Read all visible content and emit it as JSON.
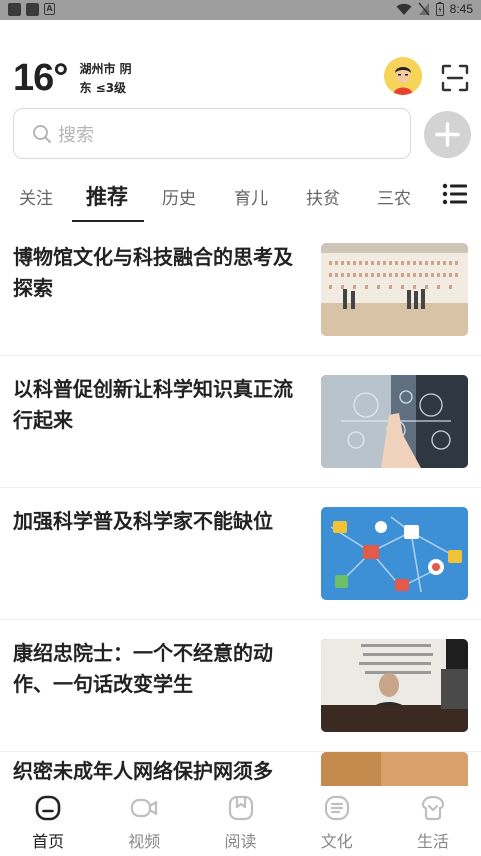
{
  "status_bar": {
    "time": "8:45"
  },
  "weather": {
    "temperature": "16°",
    "location_condition": "湖州市 阴",
    "wind": "东 ≤3级"
  },
  "search": {
    "placeholder": "搜索"
  },
  "tabs": [
    {
      "label": "关注"
    },
    {
      "label": "推荐",
      "active": true
    },
    {
      "label": "历史"
    },
    {
      "label": "育儿"
    },
    {
      "label": "扶贫"
    },
    {
      "label": "三农"
    }
  ],
  "feed": [
    {
      "title": "博物馆文化与科技融合的思考及探索"
    },
    {
      "title": "以科普促创新让科学知识真正流行起来"
    },
    {
      "title": "加强科学普及科学家不能缺位"
    },
    {
      "title": "康绍忠院士：一个不经意的动作、一句话改变学生"
    },
    {
      "title": "织密未成年人网络保护网须多"
    }
  ],
  "bottom_nav": [
    {
      "label": "首页",
      "icon": "home-icon",
      "active": true
    },
    {
      "label": "视频",
      "icon": "video-icon"
    },
    {
      "label": "阅读",
      "icon": "read-icon"
    },
    {
      "label": "文化",
      "icon": "culture-icon"
    },
    {
      "label": "生活",
      "icon": "life-icon"
    }
  ],
  "colors": {
    "text_primary": "#222222",
    "text_secondary": "#888888",
    "status_bar": "#9e9e9e",
    "plus_button": "#d3d3d3",
    "avatar_bg": "#f6d45a"
  }
}
